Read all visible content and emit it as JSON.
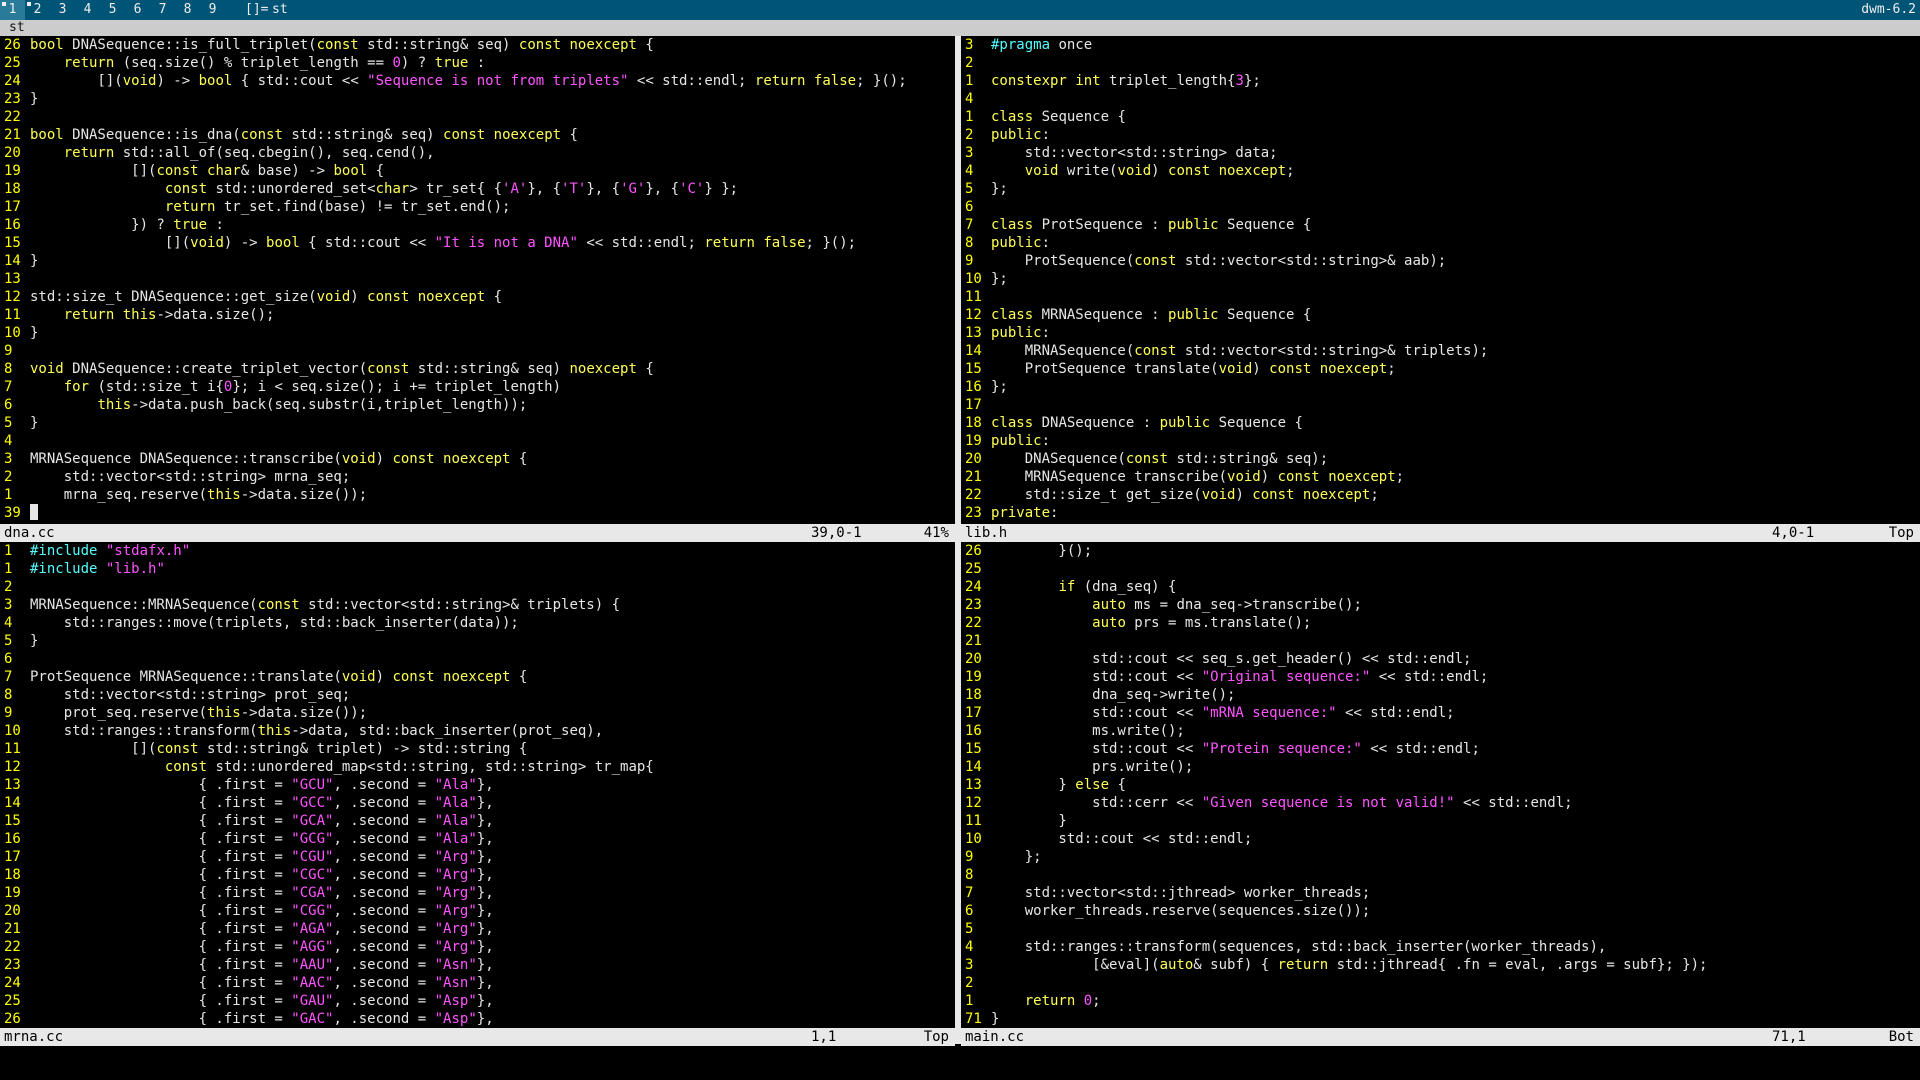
{
  "bar": {
    "tags": [
      "1",
      "2",
      "3",
      "4",
      "5",
      "6",
      "7",
      "8",
      "9"
    ],
    "selected_tag": "1",
    "layout_symbol": "[]=",
    "window_title": "st",
    "status": "dwm-6.2"
  },
  "window": {
    "title": "st"
  },
  "panes": [
    {
      "id": "top-left",
      "filename": "dna.cc",
      "position": "39,0-1",
      "percent": "41%",
      "lines": [
        {
          "n": "26",
          "c": "bool DNASequence::is_full_triplet(const std::string& seq) const noexcept {"
        },
        {
          "n": "25",
          "c": "    return (seq.size() % triplet_length == 0) ? true :"
        },
        {
          "n": "24",
          "c": "        [](void) -> bool { std::cout << \"Sequence is not from triplets\" << std::endl; return false; }();"
        },
        {
          "n": "23",
          "c": "}"
        },
        {
          "n": "22",
          "c": ""
        },
        {
          "n": "21",
          "c": "bool DNASequence::is_dna(const std::string& seq) const noexcept {"
        },
        {
          "n": "20",
          "c": "    return std::all_of(seq.cbegin(), seq.cend(),"
        },
        {
          "n": "19",
          "c": "            [](const char& base) -> bool {"
        },
        {
          "n": "18",
          "c": "                const std::unordered_set<char> tr_set{ {'A'}, {'T'}, {'G'}, {'C'} };"
        },
        {
          "n": "17",
          "c": "                return tr_set.find(base) != tr_set.end();"
        },
        {
          "n": "16",
          "c": "            }) ? true :"
        },
        {
          "n": "15",
          "c": "                [](void) -> bool { std::cout << \"It is not a DNA\" << std::endl; return false; }();"
        },
        {
          "n": "14",
          "c": "}"
        },
        {
          "n": "13",
          "c": ""
        },
        {
          "n": "12",
          "c": "std::size_t DNASequence::get_size(void) const noexcept {"
        },
        {
          "n": "11",
          "c": "    return this->data.size();"
        },
        {
          "n": "10",
          "c": "}"
        },
        {
          "n": "9",
          "c": ""
        },
        {
          "n": "8",
          "c": "void DNASequence::create_triplet_vector(const std::string& seq) noexcept {"
        },
        {
          "n": "7",
          "c": "    for (std::size_t i{0}; i < seq.size(); i += triplet_length)"
        },
        {
          "n": "6",
          "c": "        this->data.push_back(seq.substr(i,triplet_length));"
        },
        {
          "n": "5",
          "c": "}"
        },
        {
          "n": "4",
          "c": ""
        },
        {
          "n": "3",
          "c": "MRNASequence DNASequence::transcribe(void) const noexcept {"
        },
        {
          "n": "2",
          "c": "    std::vector<std::string> mrna_seq;"
        },
        {
          "n": "1",
          "c": "    mrna_seq.reserve(this->data.size());"
        },
        {
          "n": "39",
          "c": ""
        }
      ]
    },
    {
      "id": "top-right",
      "filename": "lib.h",
      "position": "4,0-1",
      "percent": "Top",
      "lines": [
        {
          "n": "3",
          "c": "#pragma once"
        },
        {
          "n": "2",
          "c": ""
        },
        {
          "n": "1",
          "c": "constexpr int triplet_length{3};"
        },
        {
          "n": "4",
          "c": ""
        },
        {
          "n": "1",
          "c": "class Sequence {"
        },
        {
          "n": "2",
          "c": "public:"
        },
        {
          "n": "3",
          "c": "    std::vector<std::string> data;"
        },
        {
          "n": "4",
          "c": "    void write(void) const noexcept;"
        },
        {
          "n": "5",
          "c": "};"
        },
        {
          "n": "6",
          "c": ""
        },
        {
          "n": "7",
          "c": "class ProtSequence : public Sequence {"
        },
        {
          "n": "8",
          "c": "public:"
        },
        {
          "n": "9",
          "c": "    ProtSequence(const std::vector<std::string>& aab);"
        },
        {
          "n": "10",
          "c": "};"
        },
        {
          "n": "11",
          "c": ""
        },
        {
          "n": "12",
          "c": "class MRNASequence : public Sequence {"
        },
        {
          "n": "13",
          "c": "public:"
        },
        {
          "n": "14",
          "c": "    MRNASequence(const std::vector<std::string>& triplets);"
        },
        {
          "n": "15",
          "c": "    ProtSequence translate(void) const noexcept;"
        },
        {
          "n": "16",
          "c": "};"
        },
        {
          "n": "17",
          "c": ""
        },
        {
          "n": "18",
          "c": "class DNASequence : public Sequence {"
        },
        {
          "n": "19",
          "c": "public:"
        },
        {
          "n": "20",
          "c": "    DNASequence(const std::string& seq);"
        },
        {
          "n": "21",
          "c": "    MRNASequence transcribe(void) const noexcept;"
        },
        {
          "n": "22",
          "c": "    std::size_t get_size(void) const noexcept;"
        },
        {
          "n": "23",
          "c": "private:"
        }
      ]
    },
    {
      "id": "bottom-left",
      "filename": "mrna.cc",
      "position": "1,1",
      "percent": "Top",
      "lines": [
        {
          "n": "1",
          "c": "#include \"stdafx.h\""
        },
        {
          "n": "1",
          "c": "#include \"lib.h\""
        },
        {
          "n": "2",
          "c": ""
        },
        {
          "n": "3",
          "c": "MRNASequence::MRNASequence(const std::vector<std::string>& triplets) {"
        },
        {
          "n": "4",
          "c": "    std::ranges::move(triplets, std::back_inserter(data));"
        },
        {
          "n": "5",
          "c": "}"
        },
        {
          "n": "6",
          "c": ""
        },
        {
          "n": "7",
          "c": "ProtSequence MRNASequence::translate(void) const noexcept {"
        },
        {
          "n": "8",
          "c": "    std::vector<std::string> prot_seq;"
        },
        {
          "n": "9",
          "c": "    prot_seq.reserve(this->data.size());"
        },
        {
          "n": "10",
          "c": "    std::ranges::transform(this->data, std::back_inserter(prot_seq),"
        },
        {
          "n": "11",
          "c": "            [](const std::string& triplet) -> std::string {"
        },
        {
          "n": "12",
          "c": "                const std::unordered_map<std::string, std::string> tr_map{"
        },
        {
          "n": "13",
          "c": "                    { .first = \"GCU\", .second = \"Ala\"},"
        },
        {
          "n": "14",
          "c": "                    { .first = \"GCC\", .second = \"Ala\"},"
        },
        {
          "n": "15",
          "c": "                    { .first = \"GCA\", .second = \"Ala\"},"
        },
        {
          "n": "16",
          "c": "                    { .first = \"GCG\", .second = \"Ala\"},"
        },
        {
          "n": "17",
          "c": "                    { .first = \"CGU\", .second = \"Arg\"},"
        },
        {
          "n": "18",
          "c": "                    { .first = \"CGC\", .second = \"Arg\"},"
        },
        {
          "n": "19",
          "c": "                    { .first = \"CGA\", .second = \"Arg\"},"
        },
        {
          "n": "20",
          "c": "                    { .first = \"CGG\", .second = \"Arg\"},"
        },
        {
          "n": "21",
          "c": "                    { .first = \"AGA\", .second = \"Arg\"},"
        },
        {
          "n": "22",
          "c": "                    { .first = \"AGG\", .second = \"Arg\"},"
        },
        {
          "n": "23",
          "c": "                    { .first = \"AAU\", .second = \"Asn\"},"
        },
        {
          "n": "24",
          "c": "                    { .first = \"AAC\", .second = \"Asn\"},"
        },
        {
          "n": "25",
          "c": "                    { .first = \"GAU\", .second = \"Asp\"},"
        },
        {
          "n": "26",
          "c": "                    { .first = \"GAC\", .second = \"Asp\"},"
        }
      ]
    },
    {
      "id": "bottom-right",
      "filename": "main.cc",
      "position": "71,1",
      "percent": "Bot",
      "lines": [
        {
          "n": "26",
          "c": "        }();"
        },
        {
          "n": "25",
          "c": ""
        },
        {
          "n": "24",
          "c": "        if (dna_seq) {"
        },
        {
          "n": "23",
          "c": "            auto ms = dna_seq->transcribe();"
        },
        {
          "n": "22",
          "c": "            auto prs = ms.translate();"
        },
        {
          "n": "21",
          "c": ""
        },
        {
          "n": "20",
          "c": "            std::cout << seq_s.get_header() << std::endl;"
        },
        {
          "n": "19",
          "c": "            std::cout << \"Original sequence:\" << std::endl;"
        },
        {
          "n": "18",
          "c": "            dna_seq->write();"
        },
        {
          "n": "17",
          "c": "            std::cout << \"mRNA sequence:\" << std::endl;"
        },
        {
          "n": "16",
          "c": "            ms.write();"
        },
        {
          "n": "15",
          "c": "            std::cout << \"Protein sequence:\" << std::endl;"
        },
        {
          "n": "14",
          "c": "            prs.write();"
        },
        {
          "n": "13",
          "c": "        } else {"
        },
        {
          "n": "12",
          "c": "            std::cerr << \"Given sequence is not valid!\" << std::endl;"
        },
        {
          "n": "11",
          "c": "        }"
        },
        {
          "n": "10",
          "c": "        std::cout << std::endl;"
        },
        {
          "n": "9",
          "c": "    };"
        },
        {
          "n": "8",
          "c": ""
        },
        {
          "n": "7",
          "c": "    std::vector<std::jthread> worker_threads;"
        },
        {
          "n": "6",
          "c": "    worker_threads.reserve(sequences.size());"
        },
        {
          "n": "5",
          "c": ""
        },
        {
          "n": "4",
          "c": "    std::ranges::transform(sequences, std::back_inserter(worker_threads),"
        },
        {
          "n": "3",
          "c": "            [&eval](auto& subf) { return std::jthread{ .fn = eval, .args = subf}; });"
        },
        {
          "n": "2",
          "c": ""
        },
        {
          "n": "1",
          "c": "    return 0;"
        },
        {
          "n": "71",
          "c": "}"
        }
      ]
    }
  ]
}
